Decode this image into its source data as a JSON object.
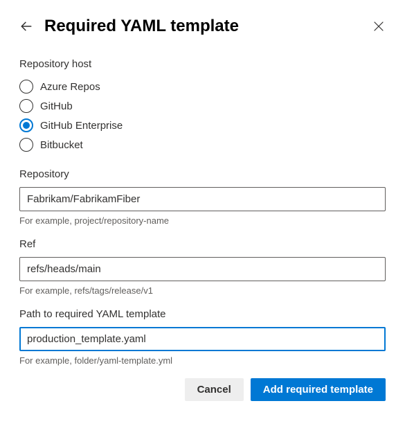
{
  "header": {
    "title": "Required YAML template"
  },
  "repositoryHost": {
    "label": "Repository host",
    "options": [
      {
        "label": "Azure Repos",
        "selected": false
      },
      {
        "label": "GitHub",
        "selected": false
      },
      {
        "label": "GitHub Enterprise",
        "selected": true
      },
      {
        "label": "Bitbucket",
        "selected": false
      }
    ]
  },
  "repository": {
    "label": "Repository",
    "value": "Fabrikam/FabrikamFiber",
    "hint": "For example, project/repository-name"
  },
  "ref": {
    "label": "Ref",
    "value": "refs/heads/main",
    "hint": "For example, refs/tags/release/v1"
  },
  "path": {
    "label": "Path to required YAML template",
    "value": "production_template.yaml",
    "hint": "For example, folder/yaml-template.yml"
  },
  "buttons": {
    "cancel": "Cancel",
    "submit": "Add required template"
  }
}
